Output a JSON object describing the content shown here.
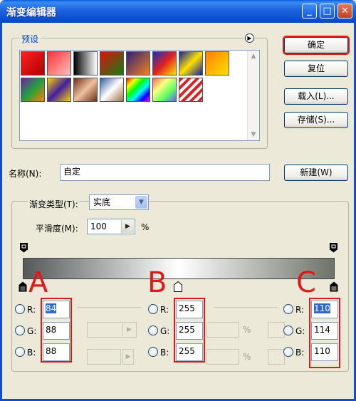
{
  "window": {
    "title": "渐变编辑器"
  },
  "presets": {
    "legend": "预设",
    "swatches": [
      {
        "name": "gradient-red",
        "bg": "linear-gradient(135deg,#ff2020,#b00000)"
      },
      {
        "name": "gradient-red-transparent",
        "bg": "linear-gradient(135deg,#ff3030,#ffc0c0)"
      },
      {
        "name": "gradient-black-white",
        "bg": "linear-gradient(90deg,#000,#fff)"
      },
      {
        "name": "gradient-red-green",
        "bg": "linear-gradient(135deg,#e01010,#108010)"
      },
      {
        "name": "gradient-violet-orange",
        "bg": "linear-gradient(135deg,#30207a,#f08020)"
      },
      {
        "name": "gradient-blue-red-yellow",
        "bg": "linear-gradient(135deg,#1030c0,#e02020,#ffe000)"
      },
      {
        "name": "gradient-blue-yellow-blue",
        "bg": "linear-gradient(135deg,#1020a0,#ffe000,#1020a0)"
      },
      {
        "name": "gradient-orange-yellow",
        "bg": "linear-gradient(135deg,#ff8000,#ffe000)"
      },
      {
        "name": "gradient-violet-green-orange",
        "bg": "linear-gradient(135deg,#7020a0,#20a040,#ff8000)"
      },
      {
        "name": "gradient-yellow-violet",
        "bg": "linear-gradient(135deg,#ffd000,#4020a0,#ffd000)"
      },
      {
        "name": "gradient-copper",
        "bg": "linear-gradient(135deg,#6a3018,#f0c0a0,#6a3018)"
      },
      {
        "name": "gradient-chrome",
        "bg": "linear-gradient(135deg,#3060a0,#ffffff,#a07040)"
      },
      {
        "name": "gradient-spectrum",
        "bg": "linear-gradient(135deg,#ff0000,#ffff00,#00ff00,#00ffff,#0000ff,#ff00ff)"
      },
      {
        "name": "gradient-transparent-rainbow",
        "bg": "linear-gradient(135deg,#ff6060,#ffff80,#60ff60,#6060ff)"
      },
      {
        "name": "gradient-transparent-stripes",
        "bg": "repeating-linear-gradient(135deg,#e02020 0 4px,#ffffff 4px 8px)"
      }
    ]
  },
  "buttons": {
    "ok": "确定",
    "reset": "复位",
    "load": "载入(L)...",
    "save": "存储(S)...",
    "new": "新建(W)"
  },
  "name_field": {
    "label": "名称(N):",
    "value": "自定"
  },
  "gradient_type": {
    "label": "渐变类型(T):",
    "value": "实底"
  },
  "smoothness": {
    "label": "平滑度(M):",
    "value": "100",
    "unit": "%"
  },
  "stops": {
    "A": {
      "letter": "A",
      "r": "84",
      "g": "88",
      "b": "88"
    },
    "B": {
      "letter": "B",
      "r": "255",
      "g": "255",
      "b": "255"
    },
    "C": {
      "letter": "C",
      "r": "110",
      "g": "114",
      "b": "110"
    }
  },
  "channel_labels": {
    "r": "R:",
    "g": "G:",
    "b": "B:"
  },
  "percent": "%",
  "colors": {
    "accent_red": "#e01818",
    "title_blue": "#0b4fd0"
  }
}
